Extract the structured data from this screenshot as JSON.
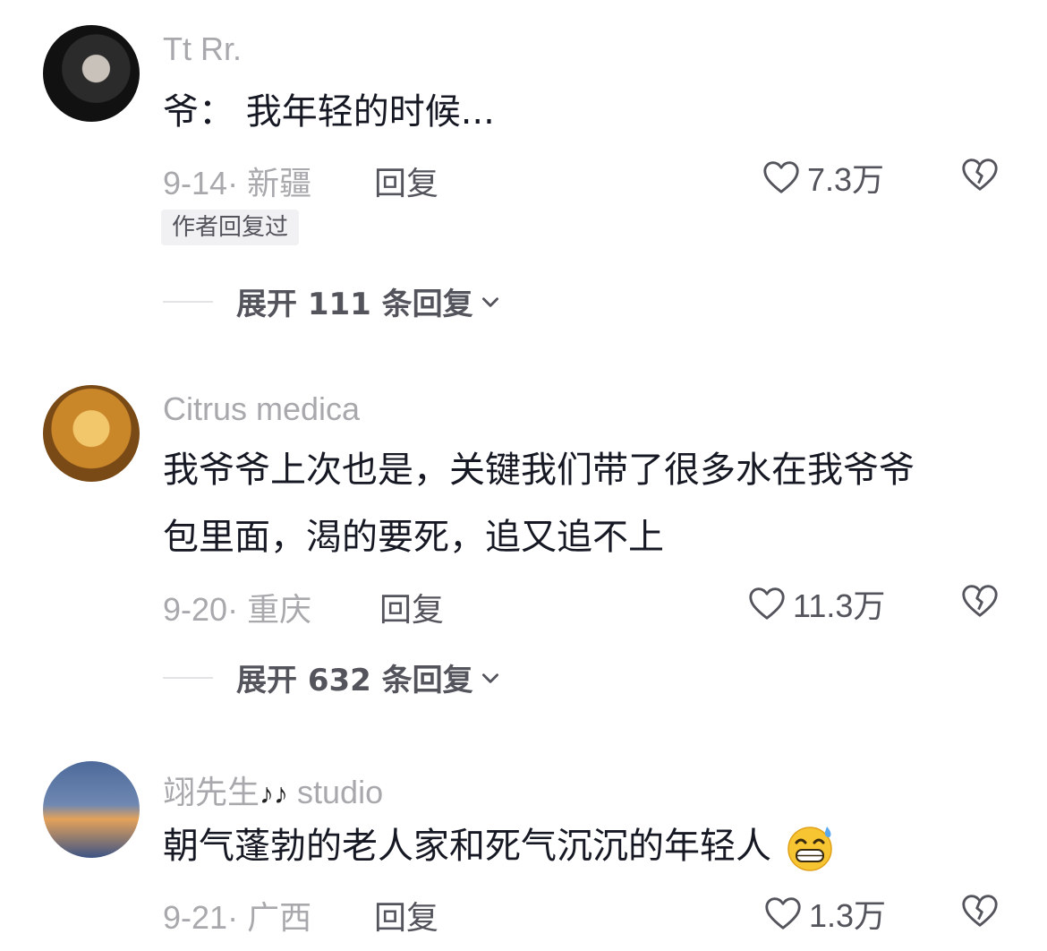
{
  "comments": [
    {
      "username": "Tt Rr.",
      "text_lines": [
        "爷：  我年轻的时候..."
      ],
      "date": "9-14",
      "location": "新疆",
      "reply_label": "回复",
      "likes": "7.3万",
      "badge": "作者回复过",
      "expand_label": "展开 111 条回复"
    },
    {
      "username": "Citrus medica",
      "text_lines": [
        "我爷爷上次也是，关键我们带了很多水在我爷爷",
        "包里面，渴的要死，追又追不上"
      ],
      "date": "9-20",
      "location": "重庆",
      "reply_label": "回复",
      "likes": "11.3万",
      "expand_label": "展开 632 条回复"
    },
    {
      "username": "翊先生",
      "username_suffix": "studio",
      "music_icon": "♪♪",
      "text_lines": [
        "朝气蓬勃的老人家和死气沉沉的年轻人"
      ],
      "date": "9-21",
      "location": "广西",
      "reply_label": "回复",
      "likes": "1.3万"
    }
  ],
  "icons": {
    "like": "heart-outline-icon",
    "dislike": "broken-heart-icon",
    "expand": "chevron-down-icon",
    "emoji": "grinning-sweat-emoji"
  },
  "colors": {
    "text_primary": "#161823",
    "text_secondary": "#a9a9ad",
    "text_action": "#53545c",
    "badge_bg": "#f1f1f3"
  }
}
